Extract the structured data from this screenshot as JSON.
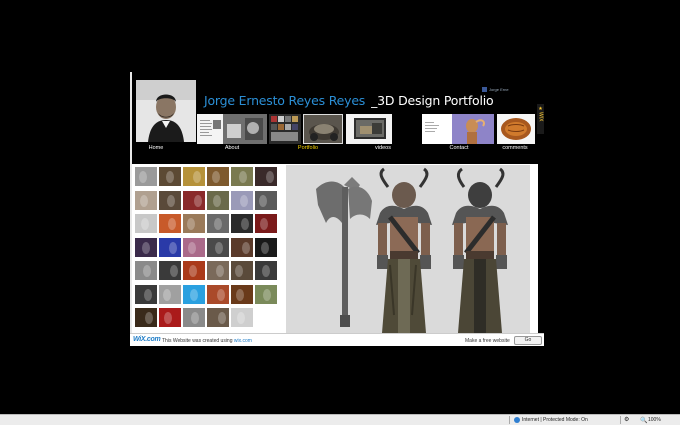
{
  "site": {
    "title_name": "Jorge Ernesto Reyes Reyes",
    "title_sub": "_3D Design Portfolio",
    "facebook_label": "Jorge Erne",
    "wix_tab": "WIX"
  },
  "nav": {
    "items": [
      {
        "label": "Home",
        "active": false
      },
      {
        "label": "About",
        "active": false
      },
      {
        "label": "Portfolio",
        "active": true
      },
      {
        "label": "videos",
        "active": false
      },
      {
        "label": "Contact",
        "active": false
      },
      {
        "label": "comments",
        "active": false
      }
    ]
  },
  "wix_bar": {
    "logo": "WiX.com",
    "text": "This Website was created using",
    "link": "wix.com",
    "free_label": "Make a free website",
    "go_label": "Go"
  },
  "status_bar": {
    "zone": "Internet | Protected Mode: On",
    "zoom": "100%"
  },
  "colors": {
    "title_blue": "#2b8fd6",
    "active_nav": "#f5d200",
    "background": "#000000"
  }
}
